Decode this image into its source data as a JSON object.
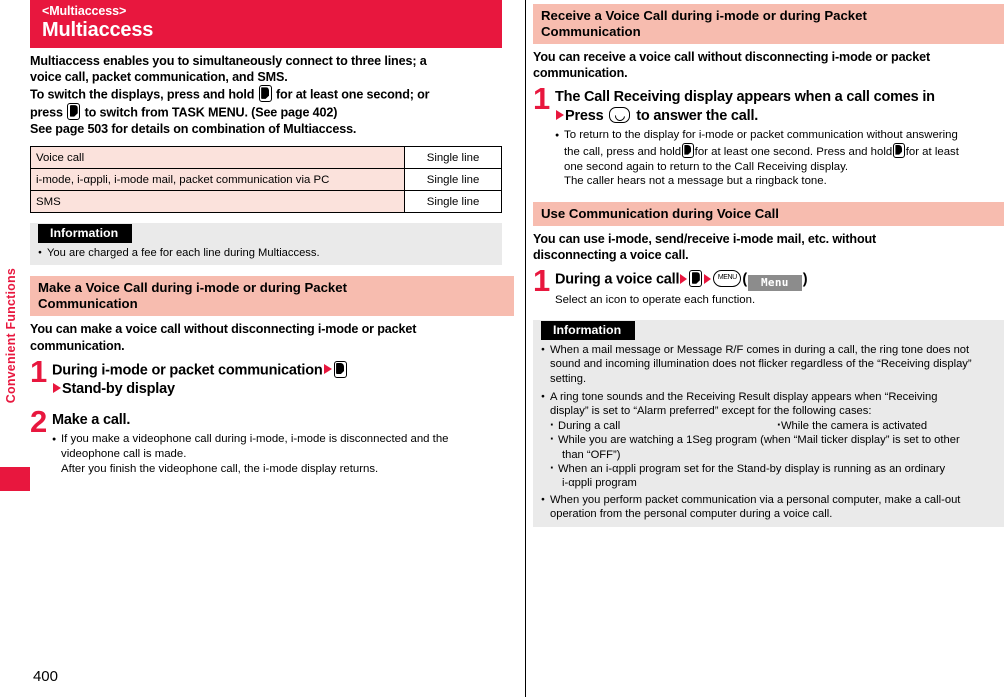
{
  "page": {
    "number": "400",
    "side_tab_label": "Convenient Functions",
    "accent_red": "#E8173E",
    "section_bar_pink": "#F7BCAF",
    "table_cell_pink": "#FBE2DC",
    "info_panel_gray": "#EAEAEA"
  },
  "left": {
    "title_kicker": "<Multiaccess>",
    "title_main": "Multiaccess",
    "intro": {
      "line1": "Multiaccess enables you to simultaneously connect to three lines; a",
      "line2": "voice call, packet communication, and SMS.",
      "line3a": "To switch the displays, press and hold",
      "line3b": "for at least one second; or",
      "line4a": "press",
      "line4b": "to switch from TASK MENU. (See page 402)",
      "line5": "See page 503 for details on combination of Multiaccess."
    },
    "table": {
      "rows": [
        {
          "desc": "Voice call",
          "value": "Single line"
        },
        {
          "desc": "i-mode, i-αppli, i-mode mail, packet communication via PC",
          "value": "Single line"
        },
        {
          "desc": "SMS",
          "value": "Single line"
        }
      ]
    },
    "information": {
      "header": "Information",
      "bullets": [
        "You are charged a fee for each line during Multiaccess."
      ]
    },
    "section2": {
      "heading_line1": "Make a Voice Call during i-mode or during Packet",
      "heading_line2": "Communication",
      "lead_line1": "You can make a voice call without disconnecting i-mode or packet",
      "lead_line2": "communication.",
      "step1": {
        "num": "1",
        "title": "During i-mode or packet communication",
        "title_line2": "Stand-by display"
      },
      "step2": {
        "num": "2",
        "title": "Make a call.",
        "bullet_line1": "If you make a videophone call during i-mode, i-mode is disconnected and the",
        "bullet_line2": "videophone call is made.",
        "bullet_line3": "After you finish the videophone call, the i-mode display returns."
      }
    }
  },
  "right": {
    "section1": {
      "heading_line1": "Receive a Voice Call during i-mode or during Packet",
      "heading_line2": "Communication",
      "lead_line1": "You can receive a voice call without disconnecting i-mode or packet",
      "lead_line2": "communication.",
      "step1": {
        "num": "1",
        "title": "The Call Receiving display appears when a call comes in",
        "title_line2a": "Press",
        "title_line2b": "to answer the call.",
        "bullet_line1": "To return to the display for i-mode or packet communication without answering",
        "bullet_line2a": "the call, press and hold",
        "bullet_line2b": "for at least one second. Press and hold",
        "bullet_line2c": "for at least",
        "bullet_line3": "one second again to return to the Call Receiving display.",
        "bullet_line4": "The caller hears not a message but a ringback tone."
      }
    },
    "section2": {
      "heading": "Use Communication during Voice Call",
      "lead_line1": "You can use i-mode, send/receive i-mode mail, etc. without",
      "lead_line2": "disconnecting a voice call.",
      "step1": {
        "num": "1",
        "title": "During a voice call",
        "menu_key_label": "MENU",
        "softkey_label": "Menu",
        "paren_open": "(",
        "paren_close": ")",
        "sub": "Select an icon to operate each function."
      }
    },
    "information": {
      "header": "Information",
      "b1_line1": "When a mail message or Message R/F comes in during a call, the ring tone does not",
      "b1_line2": "sound and incoming illumination does not flicker regardless of the “Receiving display”",
      "b1_line3": "setting.",
      "b2_line1": "A ring tone sounds and the Receiving Result display appears when “Receiving",
      "b2_line2": "display” is set to “Alarm preferred” except for the following cases:",
      "sub1a": "During a call",
      "sub1b": "While the camera is activated",
      "sub2_line1": "While you are watching a 1Seg program (when “Mail ticker display” is set to other",
      "sub2_line2": "than “OFF”)",
      "sub3_line1": "When an i-αppli program set for the Stand-by display is running as an ordinary",
      "sub3_line2": "i-αppli program",
      "b3_line1": "When you perform packet communication via a personal computer, make a call-out",
      "b3_line2": "operation from the personal computer during a voice call."
    }
  }
}
